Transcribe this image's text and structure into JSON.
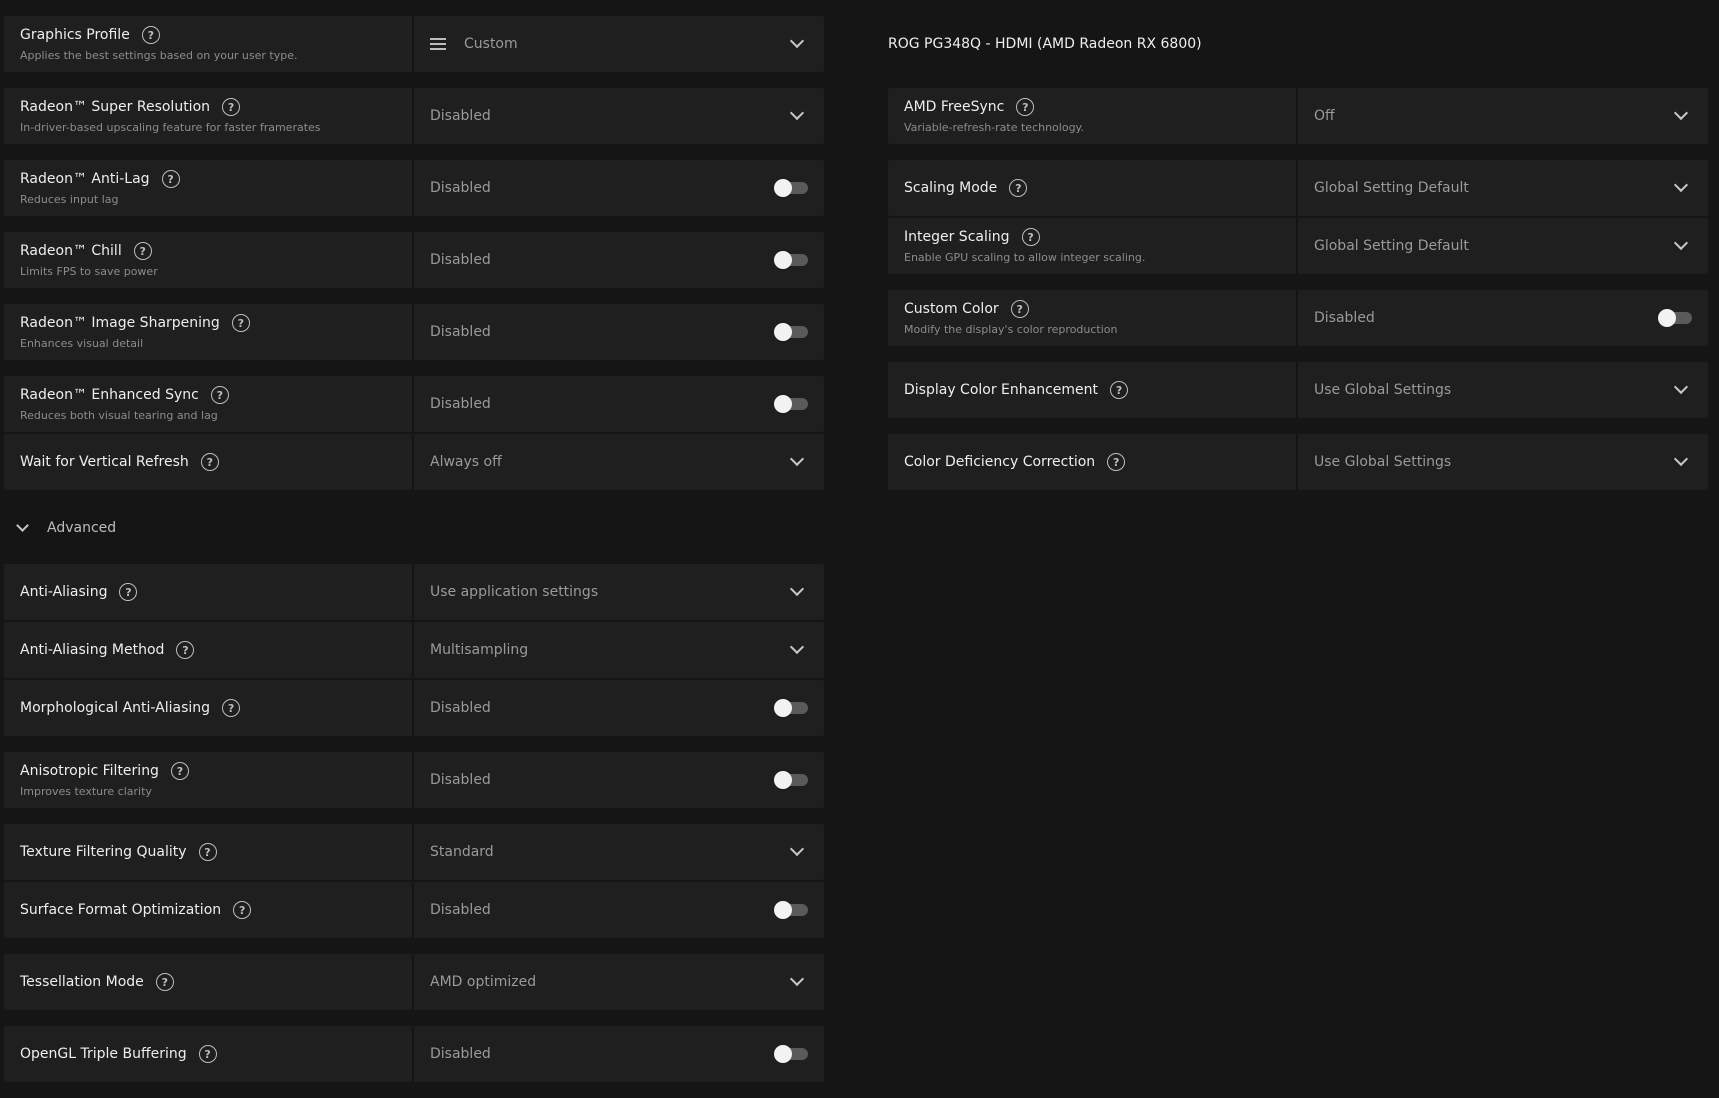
{
  "left": {
    "graphics_profile": {
      "title": "Graphics Profile",
      "desc": "Applies the best settings based on your user type.",
      "value": "Custom"
    },
    "super_resolution": {
      "title": "Radeon™ Super Resolution",
      "desc": "In-driver-based upscaling feature for faster framerates",
      "value": "Disabled"
    },
    "anti_lag": {
      "title": "Radeon™ Anti-Lag",
      "desc": "Reduces input lag",
      "value": "Disabled",
      "enabled": false
    },
    "chill": {
      "title": "Radeon™ Chill",
      "desc": "Limits FPS to save power",
      "value": "Disabled",
      "enabled": false
    },
    "image_sharpening": {
      "title": "Radeon™ Image Sharpening",
      "desc": "Enhances visual detail",
      "value": "Disabled",
      "enabled": false
    },
    "enhanced_sync": {
      "title": "Radeon™ Enhanced Sync",
      "desc": "Reduces both visual tearing and lag",
      "value": "Disabled",
      "enabled": false
    },
    "vsync": {
      "title": "Wait for Vertical Refresh",
      "value": "Always off"
    },
    "advanced_label": "Advanced",
    "anti_aliasing": {
      "title": "Anti-Aliasing",
      "value": "Use application settings"
    },
    "aa_method": {
      "title": "Anti-Aliasing Method",
      "value": "Multisampling"
    },
    "morph_aa": {
      "title": "Morphological Anti-Aliasing",
      "value": "Disabled",
      "enabled": false
    },
    "anisotropic": {
      "title": "Anisotropic Filtering",
      "desc": "Improves texture clarity",
      "value": "Disabled",
      "enabled": false
    },
    "texture_quality": {
      "title": "Texture Filtering Quality",
      "value": "Standard"
    },
    "surface_format": {
      "title": "Surface Format Optimization",
      "value": "Disabled",
      "enabled": false
    },
    "tessellation": {
      "title": "Tessellation Mode",
      "value": "AMD optimized"
    },
    "triple_buffering": {
      "title": "OpenGL Triple Buffering",
      "value": "Disabled",
      "enabled": false
    }
  },
  "right": {
    "monitor_title": "ROG PG348Q - HDMI (AMD Radeon RX 6800)",
    "freesync": {
      "title": "AMD FreeSync",
      "desc": "Variable-refresh-rate technology.",
      "value": "Off"
    },
    "scaling_mode": {
      "title": "Scaling Mode",
      "value": "Global Setting Default"
    },
    "integer_scaling": {
      "title": "Integer Scaling",
      "desc": "Enable GPU scaling to allow integer scaling.",
      "value": "Global Setting Default"
    },
    "custom_color": {
      "title": "Custom Color",
      "desc": "Modify the display's color reproduction",
      "value": "Disabled",
      "enabled": false
    },
    "color_enhancement": {
      "title": "Display Color Enhancement",
      "value": "Use Global Settings"
    },
    "color_deficiency": {
      "title": "Color Deficiency Correction",
      "value": "Use Global Settings"
    }
  },
  "icons": {
    "help": "?"
  }
}
